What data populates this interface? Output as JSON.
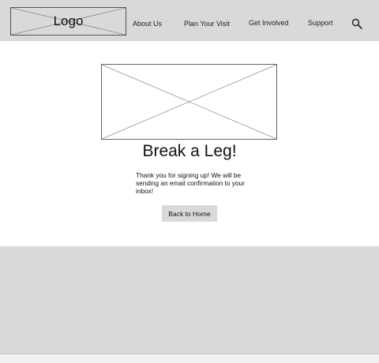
{
  "header": {
    "logo_text": "Logo",
    "nav": {
      "about": "About Us",
      "visit": "Plan Your Visit",
      "involved": "Get Involved",
      "support": "Support"
    },
    "search_icon": "search-icon"
  },
  "main": {
    "hero_image": "image-placeholder",
    "title": "Break a Leg!",
    "message": "Thank you for signing up! We will be sending an email confirmation to your inbox!",
    "back_button": "Back to Home"
  },
  "colors": {
    "header_bg": "#d9d9d9",
    "footer_bg": "#d9d9d9",
    "button_bg": "#d9d9d9",
    "page_bg": "#ffffff"
  }
}
